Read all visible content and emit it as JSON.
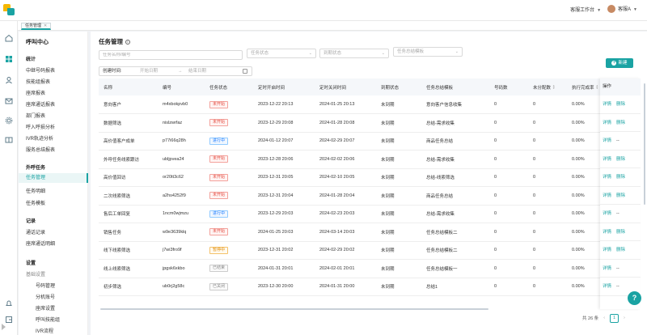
{
  "header": {
    "workbench_label": "客服工作台",
    "user_name": "客服A"
  },
  "tabs": [
    {
      "label": "任务管理"
    }
  ],
  "menu": {
    "title": "呼叫中心",
    "groups": [
      {
        "label": "统计",
        "items": [
          "中继号码报表",
          "技能组报表",
          "座席报表",
          "座席通话报表",
          "部门报表",
          "呼入呼损分析",
          "IVR轨迹分析",
          "服务总结报表"
        ]
      },
      {
        "label": "外呼任务",
        "items": [
          "任务管理",
          "任务明细",
          "任务模板"
        ]
      },
      {
        "label": "记录",
        "items": [
          "通话记录",
          "座席通话明细"
        ]
      },
      {
        "label": "设置",
        "items": [
          "基础设置",
          "号码管理",
          "分机账号",
          "座席设置",
          "呼叫技能组",
          "IVR流程"
        ]
      }
    ],
    "active_item": "任务管理"
  },
  "main": {
    "page_title": "任务管理",
    "filters": {
      "name_placeholder": "任务名称/编号",
      "status_placeholder": "任务状态",
      "expire_placeholder": "到期状态",
      "template_placeholder": "任务总结模板",
      "created_label": "创建时间:",
      "start_placeholder": "开始日期",
      "end_placeholder": "结束日期"
    },
    "new_button": "新建",
    "columns": [
      "名称",
      "编号",
      "任务状态",
      "定时开启时间",
      "定时关闭时间",
      "到期状态",
      "任务总结模板",
      "号码数",
      "未分配数",
      "执行完成率"
    ],
    "ops_header": "操作",
    "ops_detail": "详情",
    "ops_delete": "删除",
    "ops_none": "--",
    "rows": [
      {
        "name": "意向客户",
        "code": "m4xbokpvb0",
        "status": "未开始",
        "status_color": "red",
        "start": "2023-12-22 20:13",
        "end": "2024-01-25 20:13",
        "expire": "未到期",
        "template": "意向客户信息收集",
        "numbers": "0",
        "unassigned": "0",
        "rate": "0.00%",
        "ops": "both"
      },
      {
        "name": "数据筛选",
        "code": "nislzwrfaz",
        "status": "未开始",
        "status_color": "red",
        "start": "2023-12-29 20:08",
        "end": "2024-01-28 20:08",
        "expire": "未到期",
        "template": "总结-需求收集",
        "numbers": "0",
        "unassigned": "0",
        "rate": "0.00%",
        "ops": "both"
      },
      {
        "name": "高价值客户成单",
        "code": "p77i66q28h",
        "status": "进行中",
        "status_color": "blue",
        "start": "2024-01-12 20:07",
        "end": "2024-02-29 20:07",
        "expire": "未到期",
        "template": "商品任务总结",
        "numbers": "0",
        "unassigned": "0",
        "rate": "0.00%",
        "ops": "detail"
      },
      {
        "name": "外呼任务线索跟访",
        "code": "ubljpvea24",
        "status": "未开始",
        "status_color": "red",
        "start": "2023-12-28 20:06",
        "end": "2024-02-02 20:06",
        "expire": "未到期",
        "template": "总结-需求收集",
        "numbers": "0",
        "unassigned": "0",
        "rate": "0.00%",
        "ops": "both"
      },
      {
        "name": "高价值回访",
        "code": "or20tt3c62",
        "status": "未开始",
        "status_color": "red",
        "start": "2023-12-31 20:05",
        "end": "2024-02-10 20:05",
        "expire": "未到期",
        "template": "总结-线索筛选",
        "numbers": "0",
        "unassigned": "0",
        "rate": "0.00%",
        "ops": "both"
      },
      {
        "name": "二次线索筛选",
        "code": "a2hs4252f9",
        "status": "未开始",
        "status_color": "red",
        "start": "2023-12-31 20:04",
        "end": "2024-01-28 20:04",
        "expire": "未到期",
        "template": "商品任务总结",
        "numbers": "0",
        "unassigned": "0",
        "rate": "0.00%",
        "ops": "both"
      },
      {
        "name": "售后工单回复",
        "code": "1ncm0wjmzu",
        "status": "进行中",
        "status_color": "blue",
        "start": "2023-12-29 20:03",
        "end": "2024-02-23 20:03",
        "expire": "未到期",
        "template": "总结-需求收集",
        "numbers": "0",
        "unassigned": "0",
        "rate": "0.00%",
        "ops": "detail"
      },
      {
        "name": "销售任务",
        "code": "w9e3639klq",
        "status": "未开始",
        "status_color": "red",
        "start": "2024-01-25 20:03",
        "end": "2024-03-14 20:03",
        "expire": "未到期",
        "template": "任务总结模板二",
        "numbers": "0",
        "unassigned": "0",
        "rate": "0.00%",
        "ops": "both"
      },
      {
        "name": "线下线索筛选",
        "code": "j7wi3fro9f",
        "status": "暂停中",
        "status_color": "orange",
        "start": "2023-12-31 20:02",
        "end": "2024-02-29 20:02",
        "expire": "未到期",
        "template": "任务总结模板二",
        "numbers": "0",
        "unassigned": "0",
        "rate": "0.00%",
        "ops": "both"
      },
      {
        "name": "线上线索筛选",
        "code": "jpgsk6xkbo",
        "status": "已结束",
        "status_color": "gray",
        "start": "2024-01-31 20:01",
        "end": "2024-02-01 20:01",
        "expire": "未到期",
        "template": "任务总结模板一",
        "numbers": "0",
        "unassigned": "0",
        "rate": "0.00%",
        "ops": "detail"
      },
      {
        "name": "初步筛选",
        "code": "ub0rj2g58c",
        "status": "已关闭",
        "status_color": "gray",
        "start": "2023-12-30 20:00",
        "end": "2024-01-31 20:00",
        "expire": "未到期",
        "template": "总结1",
        "numbers": "0",
        "unassigned": "0",
        "rate": "0.00%",
        "ops": "detail"
      }
    ],
    "pagination": {
      "total": "共 26 条",
      "current": "1"
    }
  },
  "colors": {
    "accent": "#1aa3a3",
    "danger": "#e54d42",
    "progress": "#1677ff",
    "warning": "#e08a00"
  }
}
